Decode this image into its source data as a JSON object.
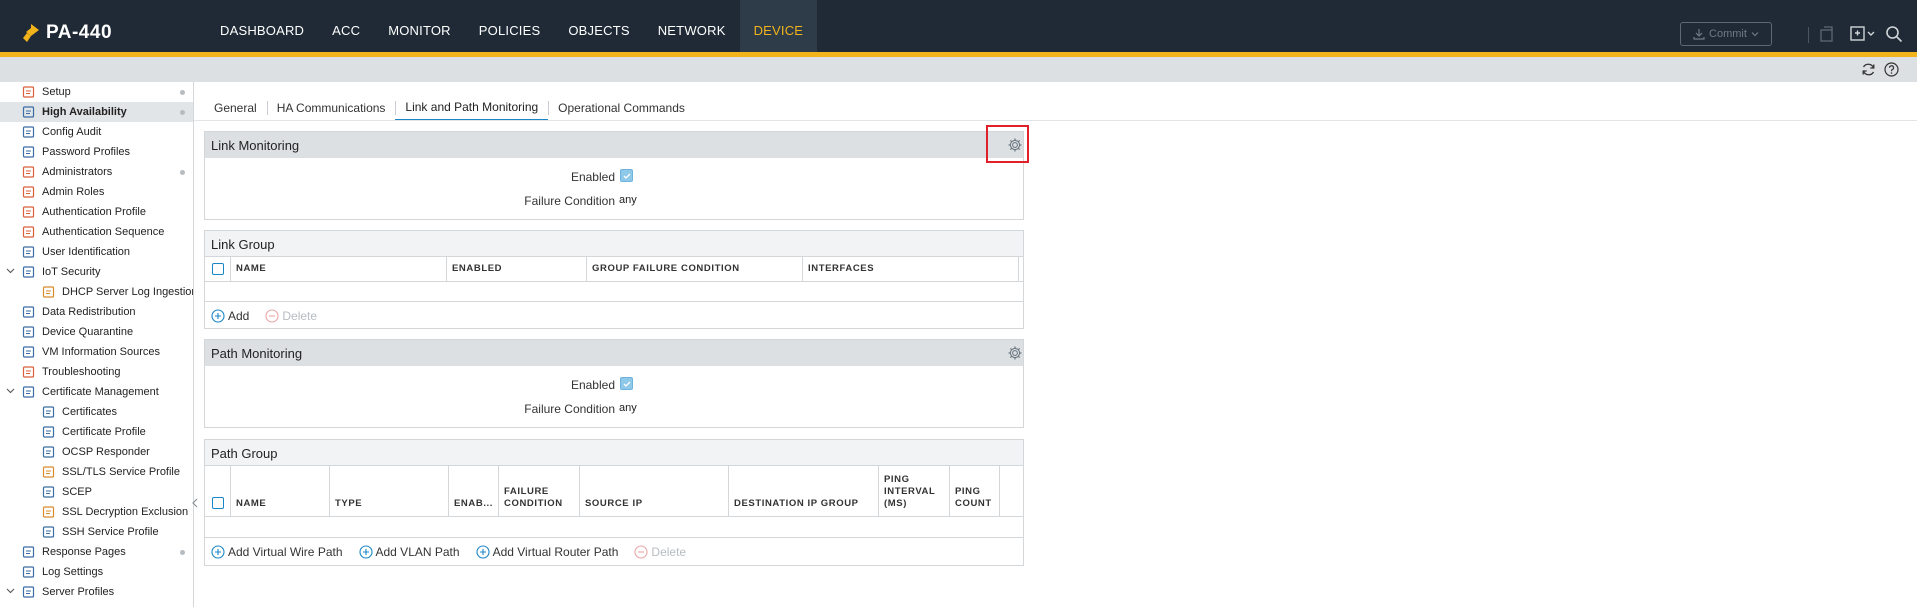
{
  "app": {
    "title": "PA-440",
    "colors": {
      "topbar": "#1f2a36",
      "accent": "#f2b31b",
      "link": "#1a86c8",
      "highlight": "#e0202a"
    }
  },
  "nav": {
    "items": [
      {
        "label": "DASHBOARD"
      },
      {
        "label": "ACC"
      },
      {
        "label": "MONITOR"
      },
      {
        "label": "POLICIES"
      },
      {
        "label": "OBJECTS"
      },
      {
        "label": "NETWORK"
      },
      {
        "label": "DEVICE",
        "active": true
      }
    ],
    "commit_label": "Commit"
  },
  "sidebar": {
    "items": [
      {
        "label": "Setup",
        "icon": "setup-icon",
        "dot": true
      },
      {
        "label": "High Availability",
        "icon": "ha-icon",
        "dot": true,
        "active": true
      },
      {
        "label": "Config Audit",
        "icon": "config-audit-icon"
      },
      {
        "label": "Password Profiles",
        "icon": "password-icon"
      },
      {
        "label": "Administrators",
        "icon": "admin-icon",
        "dot": true
      },
      {
        "label": "Admin Roles",
        "icon": "admin-roles-icon"
      },
      {
        "label": "Authentication Profile",
        "icon": "auth-profile-icon"
      },
      {
        "label": "Authentication Sequence",
        "icon": "auth-seq-icon"
      },
      {
        "label": "User Identification",
        "icon": "user-id-icon"
      },
      {
        "label": "IoT Security",
        "icon": "iot-icon",
        "expanded": true
      },
      {
        "label": "DHCP Server Log Ingestion",
        "icon": "dhcp-icon",
        "child": true
      },
      {
        "label": "Data Redistribution",
        "icon": "data-redist-icon"
      },
      {
        "label": "Device Quarantine",
        "icon": "quarantine-icon"
      },
      {
        "label": "VM Information Sources",
        "icon": "vm-icon"
      },
      {
        "label": "Troubleshooting",
        "icon": "troubleshoot-icon"
      },
      {
        "label": "Certificate Management",
        "icon": "cert-mgmt-icon",
        "expanded": true
      },
      {
        "label": "Certificates",
        "icon": "cert-icon",
        "child": true
      },
      {
        "label": "Certificate Profile",
        "icon": "cert-profile-icon",
        "child": true
      },
      {
        "label": "OCSP Responder",
        "icon": "ocsp-icon",
        "child": true
      },
      {
        "label": "SSL/TLS Service Profile",
        "icon": "lock-icon",
        "child": true
      },
      {
        "label": "SCEP",
        "icon": "scep-icon",
        "child": true
      },
      {
        "label": "SSL Decryption Exclusion",
        "icon": "lock-icon",
        "child": true
      },
      {
        "label": "SSH Service Profile",
        "icon": "ssh-icon",
        "child": true
      },
      {
        "label": "Response Pages",
        "icon": "response-icon",
        "dot": true
      },
      {
        "label": "Log Settings",
        "icon": "log-icon"
      },
      {
        "label": "Server Profiles",
        "icon": "server-icon",
        "expanded": true
      }
    ]
  },
  "tabs": [
    {
      "label": "General"
    },
    {
      "label": "HA Communications"
    },
    {
      "label": "Link and Path Monitoring",
      "active": true
    },
    {
      "label": "Operational Commands"
    }
  ],
  "link_monitoring": {
    "title": "Link Monitoring",
    "enabled_label": "Enabled",
    "failure_label": "Failure Condition",
    "failure_value": "any"
  },
  "link_group": {
    "title": "Link Group",
    "columns": [
      "NAME",
      "ENABLED",
      "GROUP FAILURE CONDITION",
      "INTERFACES"
    ],
    "add_label": "Add",
    "delete_label": "Delete"
  },
  "path_monitoring": {
    "title": "Path Monitoring",
    "enabled_label": "Enabled",
    "failure_label": "Failure Condition",
    "failure_value": "any"
  },
  "path_group": {
    "title": "Path Group",
    "columns": [
      "NAME",
      "TYPE",
      "ENAB...",
      "FAILURE CONDITION",
      "SOURCE IP",
      "DESTINATION IP GROUP",
      "PING INTERVAL (MS)",
      "PING COUNT"
    ],
    "actions": [
      "Add Virtual Wire Path",
      "Add VLAN Path",
      "Add Virtual Router Path"
    ],
    "delete_label": "Delete"
  }
}
